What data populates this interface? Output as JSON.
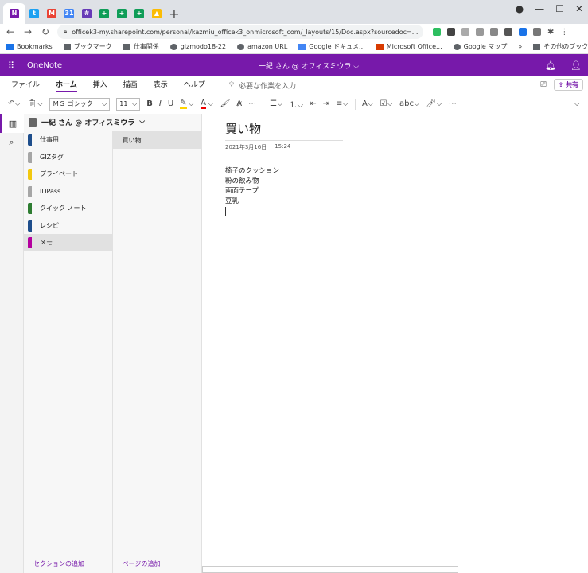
{
  "browser": {
    "tabs": [
      {
        "icon": "onenote-icon",
        "color": "#7719aa",
        "glyph": "N",
        "active": true
      },
      {
        "icon": "twitter-icon",
        "color": "#1da1f2",
        "glyph": "t"
      },
      {
        "icon": "gmail-icon",
        "color": "#ea4335",
        "glyph": "M"
      },
      {
        "icon": "calendar-icon",
        "color": "#4285f4",
        "glyph": "31"
      },
      {
        "icon": "app-grid-icon",
        "color": "#673ab7",
        "glyph": "#"
      },
      {
        "icon": "sheets-icon",
        "color": "#0f9d58",
        "glyph": "+"
      },
      {
        "icon": "sheets-icon",
        "color": "#0f9d58",
        "glyph": "+"
      },
      {
        "icon": "sheets-icon",
        "color": "#0f9d58",
        "glyph": "+"
      },
      {
        "icon": "drive-icon",
        "color": "#fbbc04",
        "glyph": "▲"
      }
    ],
    "url": "officek3-my.sharepoint.com/personal/kazmiu_officek3_onmicrosoft_com/_layouts/15/Doc.aspx?sourcedoc=...",
    "bookmarks": [
      {
        "label": "Bookmarks",
        "icon": "star-icon"
      },
      {
        "label": "ブックマーク",
        "icon": "folder-icon"
      },
      {
        "label": "仕事関係",
        "icon": "folder-icon"
      },
      {
        "label": "gizmodo18-22",
        "icon": "globe-icon"
      },
      {
        "label": "amazon URL",
        "icon": "globe-icon"
      },
      {
        "label": "Google ドキュメ...",
        "icon": "docs-icon"
      },
      {
        "label": "Microsoft Office...",
        "icon": "office-icon"
      },
      {
        "label": "Google マップ",
        "icon": "globe-icon"
      }
    ],
    "other_bookmarks": "その他のブックマーク"
  },
  "app": {
    "name": "OneNote",
    "doc_title": "一紀 さん @ オフィスミウラ ⌵"
  },
  "ribbon_tabs": [
    "ファイル",
    "ホーム",
    "挿入",
    "描画",
    "表示",
    "ヘルプ"
  ],
  "active_ribbon_tab": "ホーム",
  "tell_me": "必要な作業を入力",
  "share_label": "共有",
  "font": {
    "name": "ＭＳ ゴシック",
    "size": "11"
  },
  "notebook": {
    "name": "一紀 さん @ オフィスミウラ",
    "sections": [
      {
        "label": "仕事用",
        "color": "#1e4e8c"
      },
      {
        "label": "GIZタグ",
        "color": "#a6a6a6"
      },
      {
        "label": "プライベート",
        "color": "#f2c80f"
      },
      {
        "label": "IDPass",
        "color": "#a6a6a6"
      },
      {
        "label": "クイック ノート",
        "color": "#2e7d32"
      },
      {
        "label": "レシピ",
        "color": "#1e4e8c"
      },
      {
        "label": "メモ",
        "color": "#b4009e",
        "active": true
      }
    ],
    "pages": [
      {
        "label": "買い物"
      }
    ],
    "add_section": "セクションの追加",
    "add_page": "ページの追加"
  },
  "page": {
    "title": "買い物",
    "date": "2021年3月16日",
    "time": "15:24",
    "lines": [
      "椅子のクッション",
      "粉の飲み物",
      "両面テープ",
      "豆乳"
    ]
  }
}
